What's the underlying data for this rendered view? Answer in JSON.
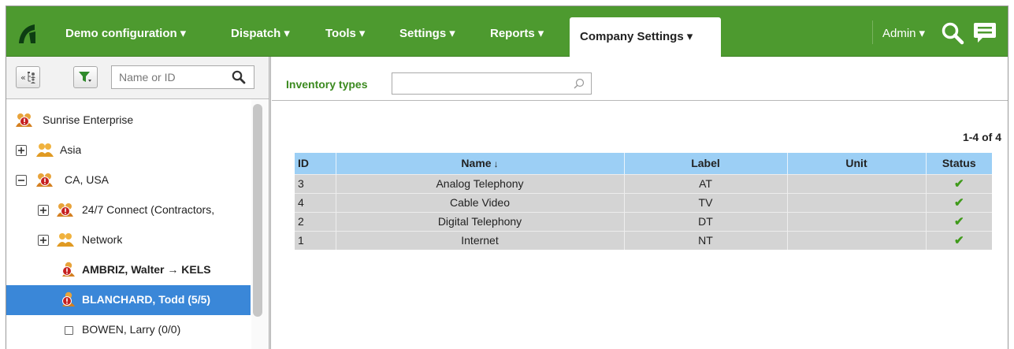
{
  "colors": {
    "brand_green": "#4d9a2f",
    "selected_blue": "#3a87d8",
    "header_blue": "#9ccff5",
    "row_gray": "#d4d4d4",
    "label_green": "#3b8a1f",
    "status_green": "#3f9a1a"
  },
  "nav": {
    "logo_icon": "app-logo-icon",
    "items": [
      {
        "label": "Demo configuration",
        "caret": "▾"
      },
      {
        "label": "Dispatch",
        "caret": "▾"
      },
      {
        "label": "Tools",
        "caret": "▾"
      },
      {
        "label": "Settings",
        "caret": "▾"
      },
      {
        "label": "Reports",
        "caret": "▾"
      }
    ],
    "active": {
      "label": "Company Settings",
      "caret": "▾"
    },
    "user": {
      "label": "Admin",
      "caret": "▾"
    }
  },
  "left": {
    "search_placeholder": "Name or ID",
    "tree": [
      {
        "label": "Sunrise Enterprise",
        "expander": "",
        "icon": "org-alert-icon"
      },
      {
        "label": "Asia",
        "expander": "plus",
        "icon": "group-icon"
      },
      {
        "label": "CA, USA",
        "expander": "minus",
        "icon": "org-alert-icon"
      },
      {
        "label": "24/7 Connect (Contractors,",
        "expander": "plus",
        "icon": "org-alert-icon"
      },
      {
        "label": "Network",
        "expander": "plus",
        "icon": "group-icon"
      },
      {
        "label": "AMBRIZ, Walter → KELS",
        "expander": "",
        "icon": "user-alert-icon"
      },
      {
        "label": "BLANCHARD, Todd (5/5)",
        "expander": "",
        "icon": "user-alert-icon",
        "selected": true
      },
      {
        "label": "BOWEN, Larry (0/0)",
        "expander": "",
        "icon": "checkbox"
      }
    ]
  },
  "right": {
    "inventory_label": "Inventory types",
    "inventory_value": "",
    "pager": "1-4 of 4",
    "table": {
      "headers": {
        "id": "ID",
        "name": "Name",
        "name_sort": "↓",
        "label": "Label",
        "unit": "Unit",
        "status": "Status"
      },
      "rows": [
        {
          "id": "3",
          "name": "Analog Telephony",
          "label": "AT",
          "unit": "",
          "status": "✔"
        },
        {
          "id": "4",
          "name": "Cable Video",
          "label": "TV",
          "unit": "",
          "status": "✔"
        },
        {
          "id": "2",
          "name": "Digital Telephony",
          "label": "DT",
          "unit": "",
          "status": "✔"
        },
        {
          "id": "1",
          "name": "Internet",
          "label": "NT",
          "unit": "",
          "status": "✔"
        }
      ]
    }
  }
}
